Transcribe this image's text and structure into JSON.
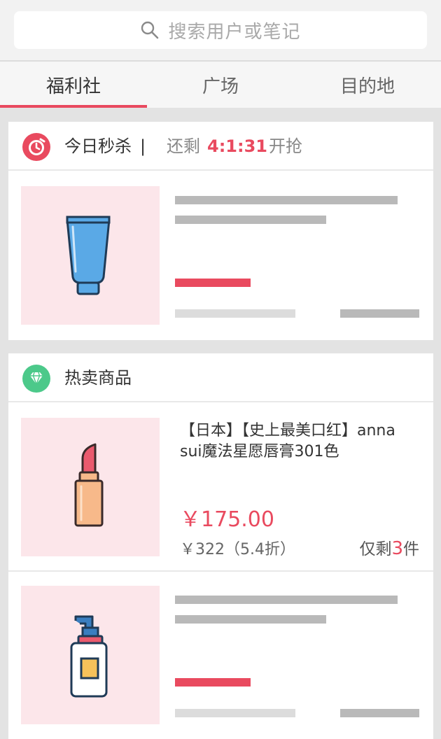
{
  "search": {
    "placeholder": "搜索用户或笔记",
    "icon": "search-icon"
  },
  "tabs": [
    {
      "label": "福利社",
      "active": true
    },
    {
      "label": "广场",
      "active": false
    },
    {
      "label": "目的地",
      "active": false
    }
  ],
  "accent_color": "#e94a5f",
  "flash_sale": {
    "icon": "alarm-clock-icon",
    "title": "今日秒杀",
    "separator": "|",
    "countdown_label": "还剩",
    "countdown_time": "4:1:31",
    "countdown_suffix": "开抢",
    "product_icon": "cream-tube-icon"
  },
  "hot_items": {
    "icon": "diamond-icon",
    "title": "热卖商品",
    "products": [
      {
        "icon": "lipstick-icon",
        "title": "【日本】【史上最美口红】anna sui魔法星愿唇膏301色",
        "price": "￥175.00",
        "original_price": "￥322（5.4折）",
        "stock_prefix": "仅剩",
        "stock_count": "3",
        "stock_suffix": "件"
      },
      {
        "icon": "lotion-bottle-icon"
      }
    ]
  }
}
